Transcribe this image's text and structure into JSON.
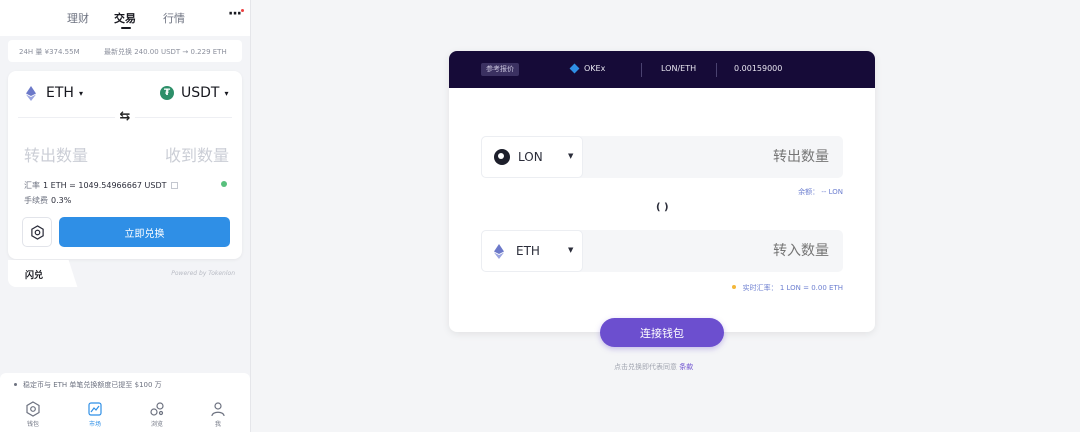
{
  "mobile": {
    "top_tabs": [
      "理财",
      "交易",
      "行情"
    ],
    "active_tab": "交易",
    "stats": {
      "volume": "24H 量 ¥374.55M",
      "latest": "最新兑换 240.00 USDT → 0.229 ETH"
    },
    "swap": {
      "from_token": "ETH",
      "to_token": "USDT",
      "from_placeholder": "转出数量",
      "to_placeholder": "收到数量",
      "rate_label": "汇率",
      "rate_value": "1 ETH = 1049.54966667 USDT",
      "fee_label": "手续费",
      "fee_value": "0.3%",
      "exchange_button": "立即兑换"
    },
    "flash_tab": "闪兑",
    "powered_by": "Powered by Tokenlon",
    "notice": "稳定币与 ETH 单笔兑换额度已提至 $100 万",
    "bottom_nav": [
      "钱包",
      "市场",
      "浏览",
      "我"
    ],
    "status_color": "#58c07d",
    "accent_color": "#2f8fe6"
  },
  "web": {
    "header": {
      "ref_label": "参考报价",
      "source": "OKEx",
      "pair": "LON/ETH",
      "price": "0.00159000"
    },
    "from_token": "LON",
    "from_placeholder": "转出数量",
    "balance": "余额： -- LON",
    "to_token": "ETH",
    "to_placeholder": "转入数量",
    "live_rate": "实时汇率： 1 LON = 0.00 ETH",
    "connect_button": "连接钱包",
    "terms_text": "点击兑换即代表同意",
    "terms_link": "条款",
    "accent_color": "#6c4fcf",
    "header_color": "#160b38"
  }
}
